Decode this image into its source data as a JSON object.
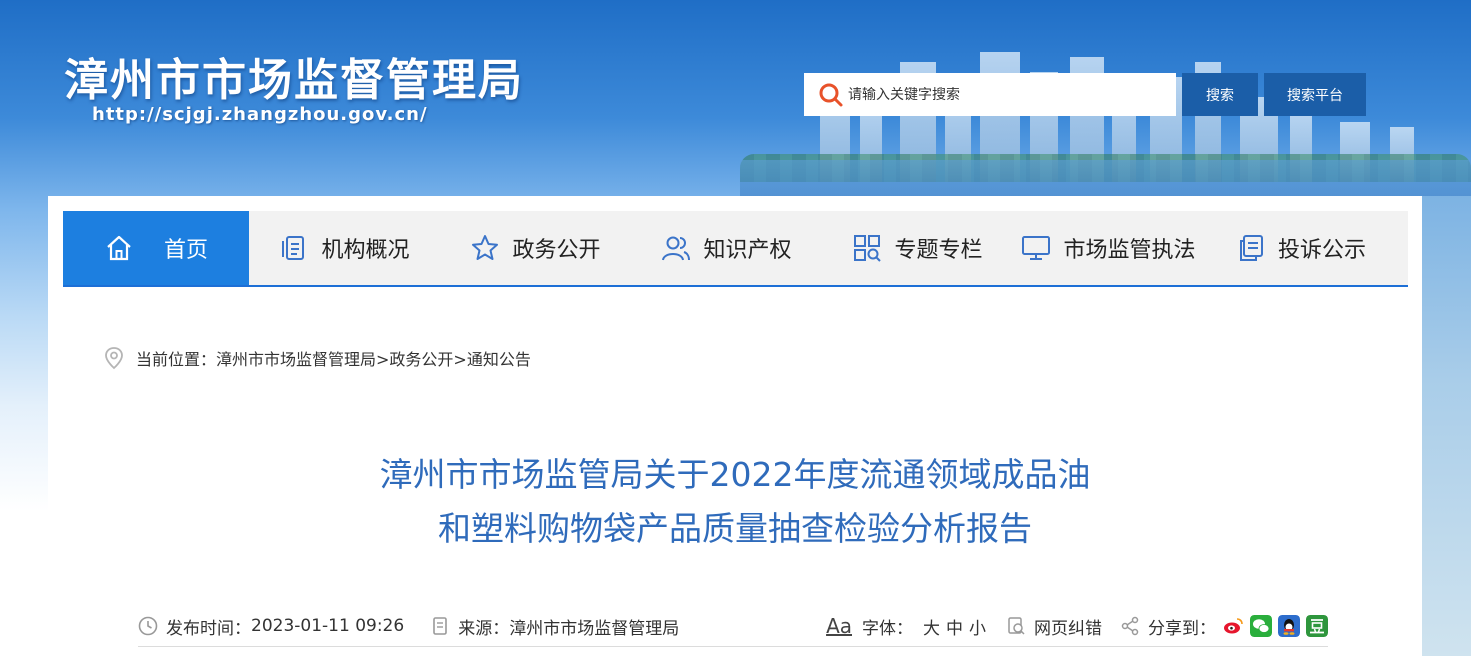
{
  "header": {
    "site_title": "漳州市市场监督管理局",
    "site_url": "http://scjgj.zhangzhou.gov.cn/",
    "search": {
      "placeholder": "请输入关键字搜索",
      "button_label": "搜索",
      "platform_label": "搜索平台"
    }
  },
  "nav": {
    "items": [
      {
        "label": "首页",
        "icon": "home-icon"
      },
      {
        "label": "机构概况",
        "icon": "document-list-icon"
      },
      {
        "label": "政务公开",
        "icon": "star-icon"
      },
      {
        "label": "知识产权",
        "icon": "users-icon"
      },
      {
        "label": "专题专栏",
        "icon": "grid-search-icon"
      },
      {
        "label": "市场监管执法",
        "icon": "monitor-icon"
      },
      {
        "label": "投诉公示",
        "icon": "copy-document-icon"
      }
    ],
    "active_index": 0
  },
  "breadcrumb": {
    "prefix": "当前位置：",
    "path": "漳州市市场监督管理局>政务公开>通知公告"
  },
  "article": {
    "title_line1": "漳州市市场监管局关于2022年度流通领域成品油",
    "title_line2": "和塑料购物袋产品质量抽查检验分析报告",
    "publish_label": "发布时间：",
    "publish_time": "2023-01-11 09:26",
    "source_label": "来源：",
    "source": "漳州市市场监督管理局",
    "font_icon_text": "Aa",
    "font_label": "字体：",
    "font_large": "大",
    "font_medium": "中",
    "font_small": "小",
    "error_label": "网页纠错",
    "share_label": "分享到："
  },
  "colors": {
    "nav_active": "#1d7fe0",
    "title_blue": "#2f6bbb",
    "button_blue": "#1b5ea8",
    "nav_underline": "#1d6fd6"
  }
}
